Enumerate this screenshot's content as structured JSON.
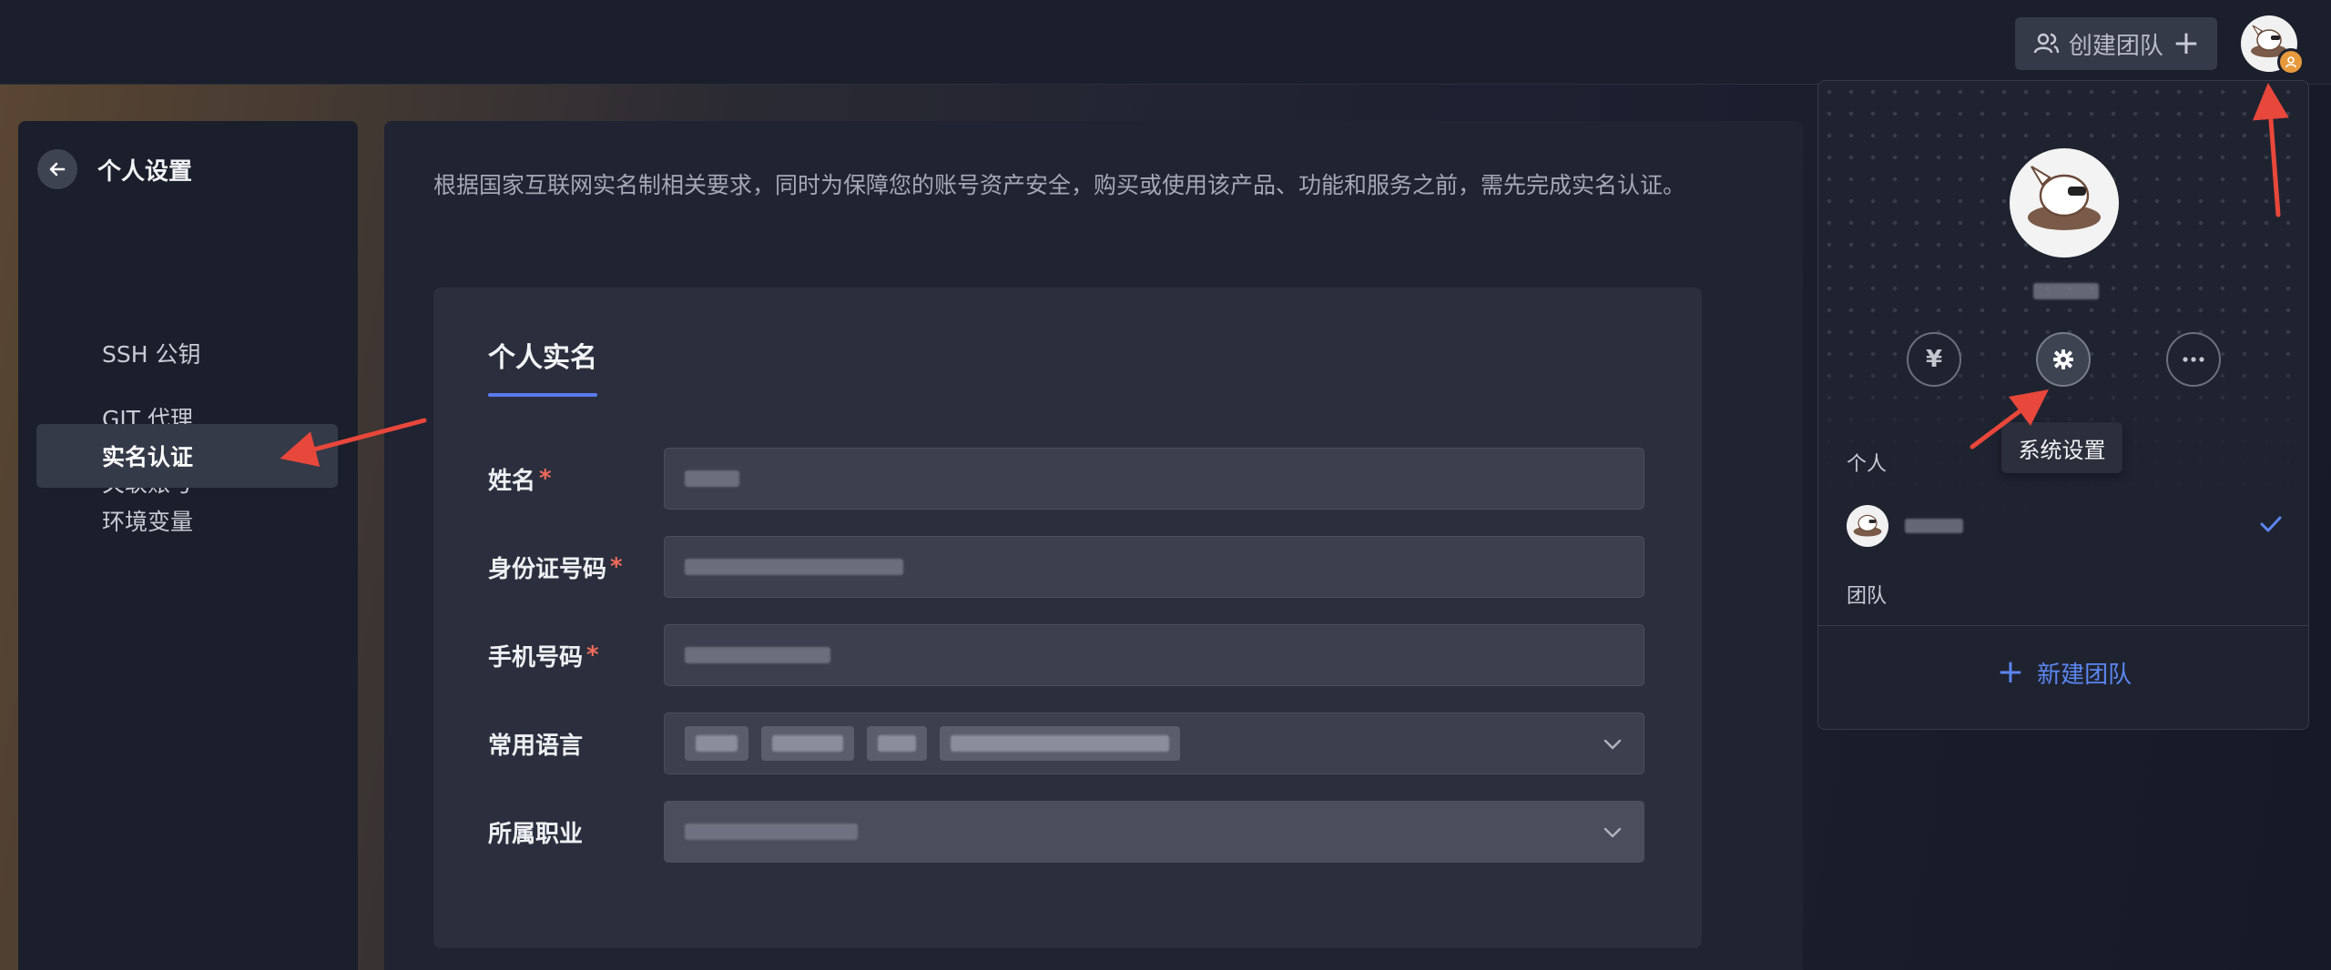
{
  "topbar": {
    "create_team_label": "创建团队",
    "create_team_icon": "users-plus-icon"
  },
  "sidebar": {
    "title": "个人设置",
    "items": [
      {
        "label": "SSH 公钥",
        "active": false
      },
      {
        "label": "GIT 代理",
        "active": false
      },
      {
        "label": "关联账号",
        "active": false
      },
      {
        "label": "实名认证",
        "active": true
      },
      {
        "label": "环境变量",
        "active": false
      }
    ]
  },
  "main": {
    "notice": "根据国家互联网实名制相关要求，同时为保障您的账号资产安全，购买或使用该产品、功能和服务之前，需先完成实名认证。",
    "card_tab": "个人实名",
    "fields": [
      {
        "label": "姓名",
        "required": true
      },
      {
        "label": "身份证号码",
        "required": true
      },
      {
        "label": "手机号码",
        "required": true
      },
      {
        "label": "常用语言",
        "required": false
      },
      {
        "label": "所属职业",
        "required": false
      }
    ]
  },
  "user_panel": {
    "tooltip": "系统设置",
    "section_personal": "个人",
    "section_team": "团队",
    "new_team_label": "新建团队"
  },
  "colors": {
    "accent": "#5b86f0",
    "required": "#ef6a5a",
    "annotation_arrow": "#e8473b"
  }
}
